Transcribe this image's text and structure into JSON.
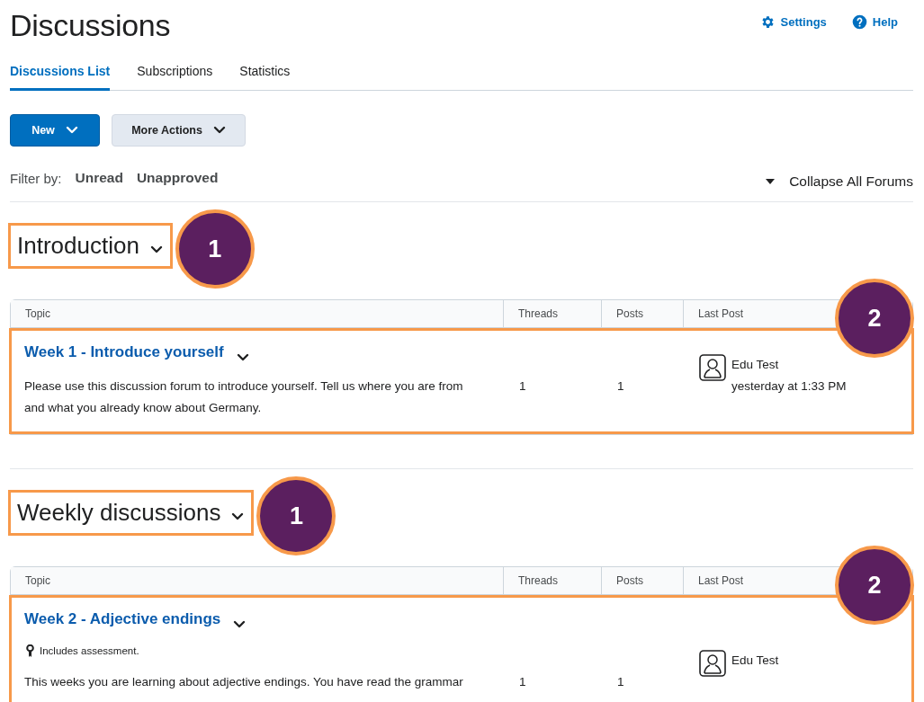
{
  "header": {
    "title": "Discussions",
    "links": [
      {
        "kind": "settings",
        "label": "Settings"
      },
      {
        "kind": "help",
        "label": "Help"
      }
    ]
  },
  "tabs": [
    {
      "label": "Discussions List",
      "selected": true
    },
    {
      "label": "Subscriptions",
      "selected": false
    },
    {
      "label": "Statistics",
      "selected": false
    }
  ],
  "actions": [
    {
      "kind": "primary",
      "label": "New"
    },
    {
      "kind": "secondary",
      "label": "More Actions"
    }
  ],
  "filter": {
    "label": "Filter by:",
    "options": [
      "Unread",
      "Unapproved"
    ]
  },
  "collapse": {
    "label": "Collapse All Forums"
  },
  "forums": [
    {
      "title": "Introduction",
      "callout": "1",
      "columns": [
        "Topic",
        "Threads",
        "Posts",
        "Last Post"
      ],
      "topics": [
        {
          "title": "Week 1 - Introduce yourself",
          "callout": "2",
          "description": "Please use this discussion forum to introduce yourself. Tell us where you are from and what you already know about Germany.",
          "threads": "1",
          "posts": "1",
          "last_post": {
            "author": "Edu Test",
            "time": "yesterday at 1:33 PM"
          }
        }
      ]
    },
    {
      "title": "Weekly discussions",
      "callout": "1",
      "columns": [
        "Topic",
        "Threads",
        "Posts",
        "Last Post"
      ],
      "topics": [
        {
          "title": "Week 2 - Adjective endings",
          "callout": "2",
          "note": "Includes assessment.",
          "description": "This weeks you are learning about adjective endings. You have read the grammar",
          "threads": "1",
          "posts": "1",
          "last_post": {
            "author": "Edu Test"
          }
        }
      ]
    }
  ]
}
